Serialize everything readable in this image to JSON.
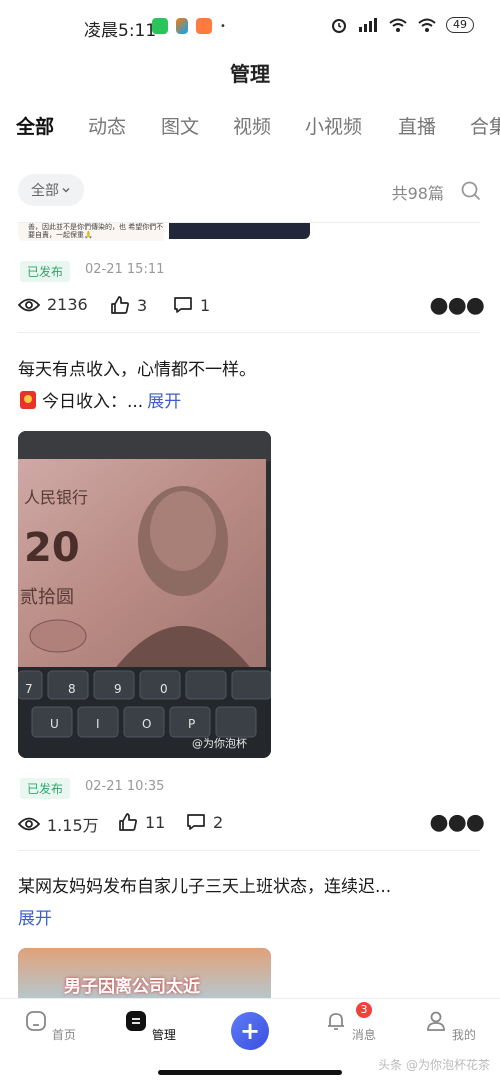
{
  "status": {
    "time": "凌晨5:11",
    "battery": "49"
  },
  "header": {
    "title": "管理"
  },
  "tabs": [
    {
      "label": "全部",
      "active": true
    },
    {
      "label": "动态"
    },
    {
      "label": "图文"
    },
    {
      "label": "视频"
    },
    {
      "label": "小视频"
    },
    {
      "label": "直播"
    },
    {
      "label": "合集"
    }
  ],
  "filter": {
    "label": "全部",
    "count": "共98篇"
  },
  "posts": [
    {
      "thumb_text": "善，因此並不是你們傳染的，也 希望你們不要自責，一起保重🙏",
      "status": "已发布",
      "datetime": "02-21 15:11",
      "views": "2136",
      "likes": "3",
      "comments": "1"
    },
    {
      "title": "每天有点收入，心情都不一样。",
      "line2": "今日收入：...",
      "expand": "展开",
      "image_watermark": "@为你泡杯",
      "status": "已发布",
      "datetime": "02-21 10:35",
      "views": "1.15万",
      "likes": "11",
      "comments": "2"
    },
    {
      "title": "某网友妈妈发布自家儿子三天上班状态，连续迟...",
      "expand": "展开",
      "image_caption": "男子因离公司太近"
    }
  ],
  "banknote": {
    "bank_text": "人民银行",
    "denomination": "20",
    "denomination_text": "贰拾圆"
  },
  "nav": {
    "home": "首页",
    "manage": "管理",
    "messages": "消息",
    "messages_badge": "3",
    "mine": "我的"
  },
  "watermark": "头条 @为你泡杯花茶",
  "colors": {
    "accent": "#3d5fc9",
    "published_green": "#2fa56e",
    "badge_red": "#f2413c"
  }
}
